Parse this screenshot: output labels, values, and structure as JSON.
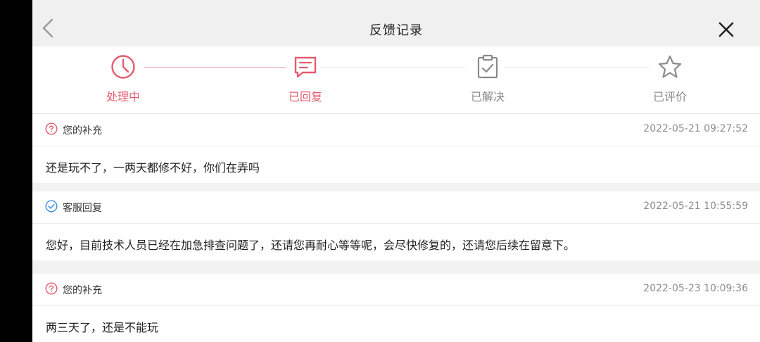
{
  "header": {
    "title": "反馈记录",
    "back_icon": "chevron-left-icon",
    "close_icon": "close-icon"
  },
  "steps": [
    {
      "label": "处理中",
      "icon": "clock-icon",
      "active": true
    },
    {
      "label": "已回复",
      "icon": "message-icon",
      "active": true
    },
    {
      "label": "已解决",
      "icon": "clipboard-check-icon",
      "active": false
    },
    {
      "label": "已评价",
      "icon": "star-icon",
      "active": false
    }
  ],
  "colors": {
    "accent": "#e45b6e",
    "inactive": "#8a8a8a",
    "reply": "#3b8fe0"
  },
  "records": [
    {
      "tag": "您的补充",
      "time": "2022-05-21 09:27:52",
      "message": "还是玩不了，一两天都修不好，你们在弄吗",
      "icon": "question-circle-icon"
    },
    {
      "tag": "客服回复",
      "time": "2022-05-21 10:55:59",
      "message": "您好，目前技术人员已经在加急排查问题了，还请您再耐心等等呢，会尽快修复的，还请您后续在留意下。",
      "icon": "check-circle-icon"
    },
    {
      "tag": "您的补充",
      "time": "2022-05-23 10:09:36",
      "message": "两三天了，还是不能玩",
      "icon": "question-circle-icon"
    }
  ]
}
